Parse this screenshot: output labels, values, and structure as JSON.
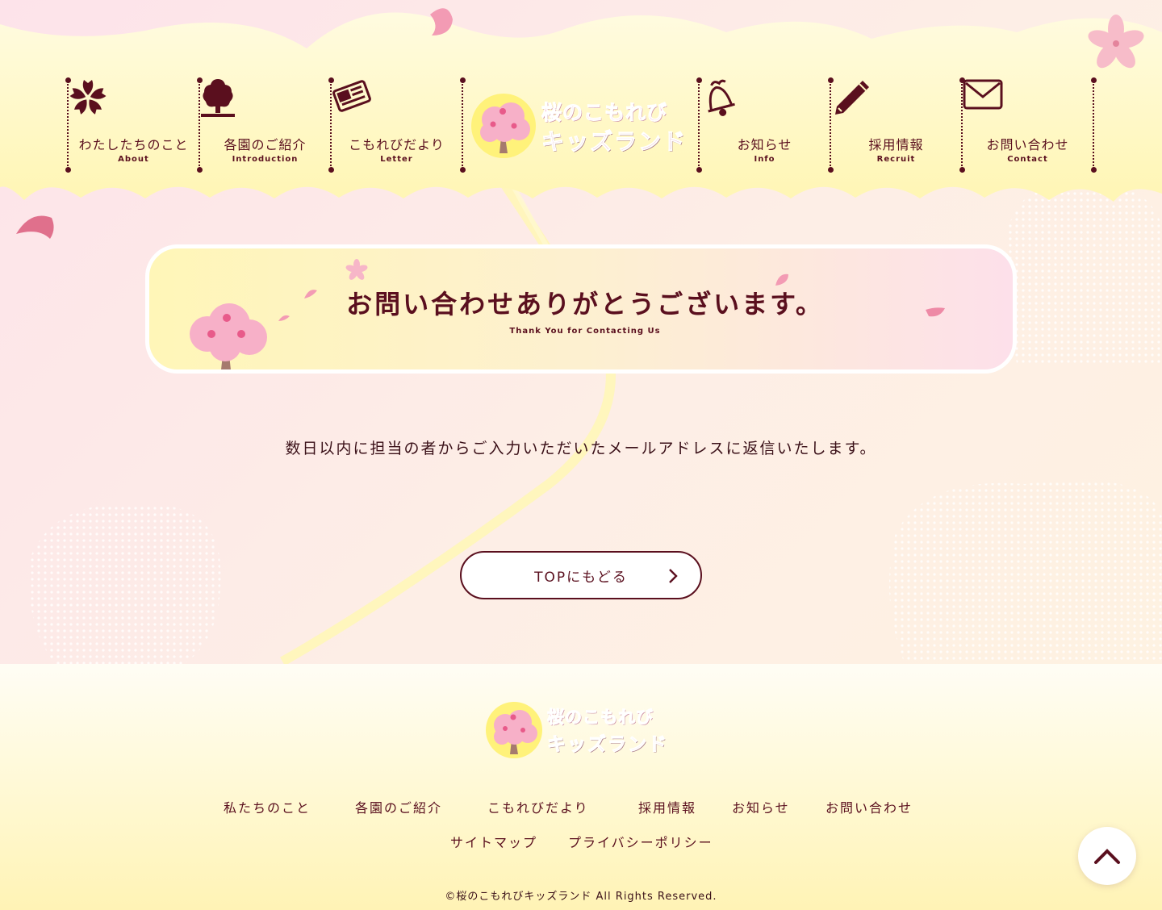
{
  "brand": {
    "logo_top": "桜のこもれび",
    "logo_bottom": "キッズランド"
  },
  "nav": {
    "items": [
      {
        "label": "わたしたちのこと",
        "sub": "About",
        "icon": "sakura-flower-icon"
      },
      {
        "label": "各園のご紹介",
        "sub": "Introduction",
        "icon": "tree-icon"
      },
      {
        "label": "こもれびだより",
        "sub": "Letter",
        "icon": "newspaper-icon"
      },
      {
        "label": "お知らせ",
        "sub": "Info",
        "icon": "bell-icon"
      },
      {
        "label": "採用情報",
        "sub": "Recruit",
        "icon": "pencil-icon"
      },
      {
        "label": "お問い合わせ",
        "sub": "Contact",
        "icon": "envelope-icon"
      }
    ]
  },
  "banner": {
    "title": "お問い合わせありがとうございます。",
    "subtitle": "Thank You for Contacting Us"
  },
  "message": "数日以内に担当の者からご入力いただいたメールアドレスに返信いたします。",
  "top_button": {
    "label": "TOPにもどる"
  },
  "footer": {
    "links": [
      "私たちのこと",
      "各園のご紹介",
      "こもれびだより",
      "採用情報",
      "お知らせ",
      "お問い合わせ"
    ],
    "links2": [
      "サイトマップ",
      "プライバシーポリシー"
    ],
    "copyright": "©桜のこもれびキッズランド All Rights Reserved."
  },
  "colors": {
    "primary": "#5a0f1e",
    "pink": "#f5a7c0",
    "yellow": "#fff6b8"
  }
}
